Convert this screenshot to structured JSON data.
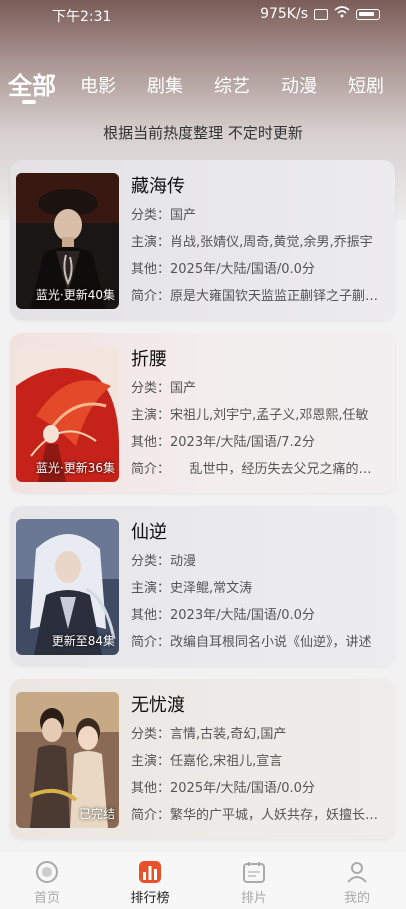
{
  "status_bar": {
    "time": "下午2:31",
    "speed": "975K/s"
  },
  "tabs": [
    {
      "label": "全部",
      "active": true
    },
    {
      "label": "电影"
    },
    {
      "label": "剧集"
    },
    {
      "label": "综艺"
    },
    {
      "label": "动漫"
    },
    {
      "label": "短剧"
    }
  ],
  "subtitle": "根据当前热度整理 不定时更新",
  "items": [
    {
      "title": "藏海传",
      "poster_label": "蓝光·更新40集",
      "category": "分类：国产",
      "cast": "主演：肖战,张婧仪,周奇,黄觉,余男,乔振宇",
      "other": "其他：2025年/大陆/国语/0.0分",
      "intro": "简介：原是大雍国钦天监监正蒯铎之子蒯藏海"
    },
    {
      "title": "折腰",
      "poster_label": "蓝光·更新36集",
      "category": "分类：国产",
      "cast": "主演：宋祖儿,刘宇宁,孟子义,邓恩熙,任敏",
      "other": "其他：2023年/大陆/国语/7.2分",
      "intro": "简介：　　乱世中，经历失去父兄之痛的乔女"
    },
    {
      "title": "仙逆",
      "poster_label": "更新至84集",
      "category": "分类：动漫",
      "cast": "主演：史泽鲲,常文涛",
      "other": "其他：2023年/大陆/国语/0.0分",
      "intro": "简介：改编自耳根同名小说《仙逆》，讲述"
    },
    {
      "title": "无忧渡",
      "poster_label": "已完结",
      "category": "分类：言情,古装,奇幻,国产",
      "cast": "主演：任嘉伦,宋祖儿,宣言",
      "other": "其他：2025年/大陆/国语/0.0分",
      "intro": "简介：繁华的广平城，人妖共存，妖擅长伪装"
    }
  ],
  "bottom_nav": [
    {
      "label": "首页",
      "icon": "home-icon"
    },
    {
      "label": "排行榜",
      "icon": "ranking-icon",
      "active": true
    },
    {
      "label": "排片",
      "icon": "calendar-icon"
    },
    {
      "label": "我的",
      "icon": "profile-icon"
    }
  ],
  "colors": {
    "accent": "#e8512a",
    "text_dark": "#111111",
    "text_meta": "#555555"
  }
}
